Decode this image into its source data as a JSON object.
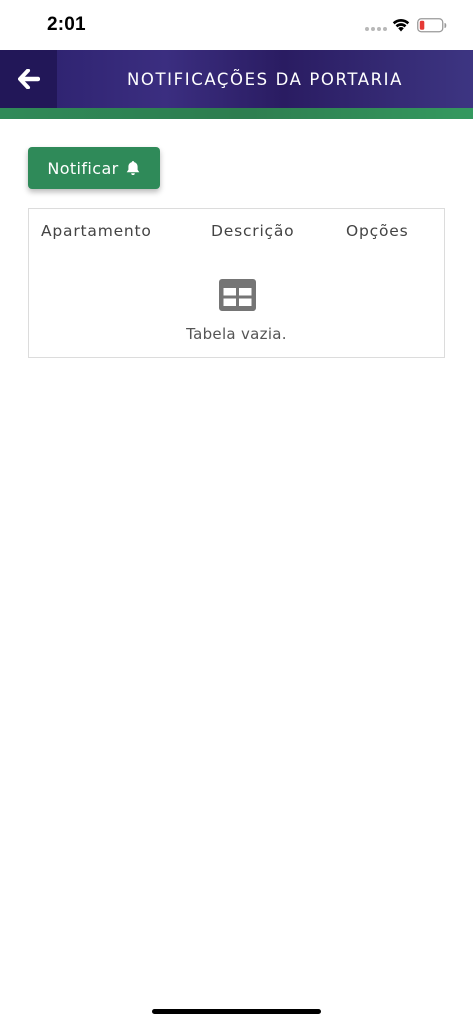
{
  "status_bar": {
    "time": "2:01"
  },
  "header": {
    "title": "NOTIFICAÇÕES DA PORTARIA",
    "back_icon": "arrow-left-icon"
  },
  "colors": {
    "header_bg": "#2a1f6b",
    "accent_green": "#2f8a59",
    "battery_low": "#e53935"
  },
  "actions": {
    "notify_label": "Notificar",
    "notify_icon": "bell-icon"
  },
  "table": {
    "columns": [
      "Apartamento",
      "Descrição",
      "Opções"
    ],
    "rows": [],
    "empty_icon": "table-icon",
    "empty_message": "Tabela vazia."
  }
}
